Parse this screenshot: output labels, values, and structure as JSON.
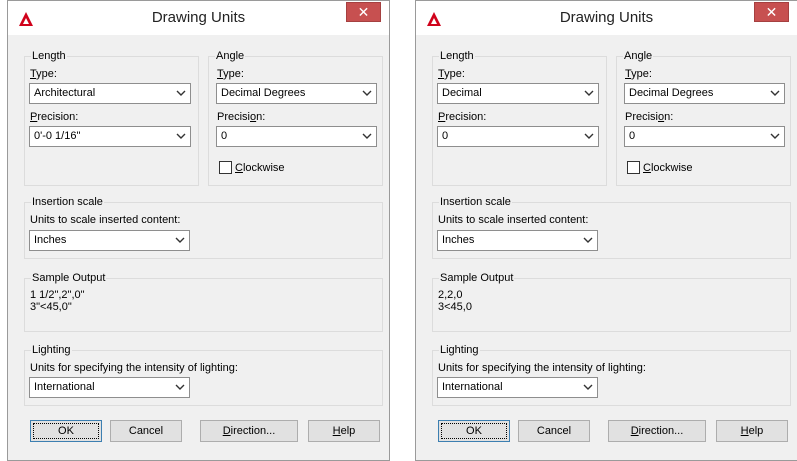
{
  "dialogs": [
    {
      "title": "Drawing Units",
      "length": {
        "group_label": "Length",
        "type_label": "Type:",
        "type_value": "Architectural",
        "precision_label": "Precision:",
        "precision_value": "0'-0 1/16\""
      },
      "angle": {
        "group_label": "Angle",
        "type_label": "Type:",
        "type_value": "Decimal Degrees",
        "precision_label": "Precision:",
        "precision_value": "0",
        "clockwise_label": "Clockwise",
        "clockwise_checked": false
      },
      "insertion": {
        "group_label": "Insertion scale",
        "units_label": "Units to scale inserted content:",
        "units_value": "Inches"
      },
      "sample": {
        "group_label": "Sample Output",
        "line1": "1 1/2\",2\",0\"",
        "line2": "3\"<45,0\""
      },
      "lighting": {
        "group_label": "Lighting",
        "units_label": "Units for specifying the intensity of lighting:",
        "units_value": "International"
      },
      "buttons": {
        "ok": "OK",
        "cancel": "Cancel",
        "direction": "Direction...",
        "help": "Help"
      }
    },
    {
      "title": "Drawing Units",
      "length": {
        "group_label": "Length",
        "type_label": "Type:",
        "type_value": "Decimal",
        "precision_label": "Precision:",
        "precision_value": "0"
      },
      "angle": {
        "group_label": "Angle",
        "type_label": "Type:",
        "type_value": "Decimal Degrees",
        "precision_label": "Precision:",
        "precision_value": "0",
        "clockwise_label": "Clockwise",
        "clockwise_checked": false
      },
      "insertion": {
        "group_label": "Insertion scale",
        "units_label": "Units to scale inserted content:",
        "units_value": "Inches"
      },
      "sample": {
        "group_label": "Sample Output",
        "line1": "2,2,0",
        "line2": "3<45,0"
      },
      "lighting": {
        "group_label": "Lighting",
        "units_label": "Units for specifying the intensity of lighting:",
        "units_value": "International"
      },
      "buttons": {
        "ok": "OK",
        "cancel": "Cancel",
        "direction": "Direction...",
        "help": "Help"
      }
    }
  ],
  "icons": {
    "app": "autocad-logo-icon",
    "close": "close-icon",
    "dropdown": "chevron-down-icon"
  },
  "colors": {
    "close_button": "#c75050",
    "app_icon": "#d0021b",
    "default_button_border": "#3c7fb1"
  }
}
